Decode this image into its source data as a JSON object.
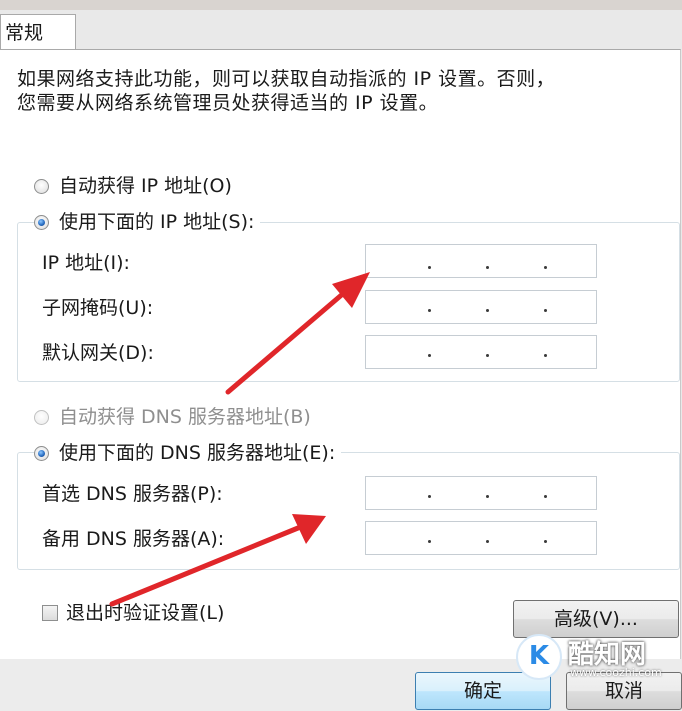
{
  "tab": {
    "label": "常规"
  },
  "description": {
    "line1": "如果网络支持此功能，则可以获取自动指派的 IP 设置。否则，",
    "line2": "您需要从网络系统管理员处获得适当的 IP 设置。"
  },
  "ip_section": {
    "auto_label": "自动获得 IP 地址(O)",
    "manual_label": "使用下面的 IP 地址(S):",
    "selected": "manual",
    "fields": [
      {
        "label": "IP 地址(I):",
        "value": ""
      },
      {
        "label": "子网掩码(U):",
        "value": ""
      },
      {
        "label": "默认网关(D):",
        "value": ""
      }
    ]
  },
  "dns_section": {
    "auto_label": "自动获得 DNS 服务器地址(B)",
    "auto_enabled": false,
    "manual_label": "使用下面的 DNS 服务器地址(E):",
    "selected": "manual",
    "fields": [
      {
        "label": "首选 DNS 服务器(P):",
        "value": ""
      },
      {
        "label": "备用 DNS 服务器(A):",
        "value": ""
      }
    ]
  },
  "validate_checkbox": {
    "label": "退出时验证设置(L)",
    "checked": false
  },
  "buttons": {
    "advanced": "高级(V)...",
    "ok": "确定",
    "cancel": "取消"
  },
  "watermark": {
    "title": "酷知网",
    "url": "www.coozhi.com",
    "logo": "K"
  },
  "colors": {
    "arrow": "#e0262a",
    "ok_button": "#bee6fd",
    "radio_dot": "#2a6fc4"
  }
}
